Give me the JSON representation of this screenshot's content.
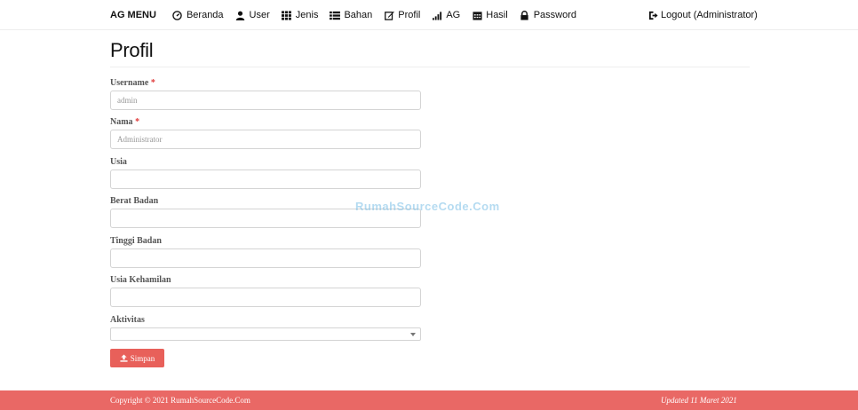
{
  "nav": {
    "brand": "AG MENU",
    "items": [
      {
        "label": "Beranda",
        "icon": "dashboard-icon"
      },
      {
        "label": "User",
        "icon": "user-icon"
      },
      {
        "label": "Jenis",
        "icon": "grid-icon"
      },
      {
        "label": "Bahan",
        "icon": "list-icon"
      },
      {
        "label": "Profil",
        "icon": "edit-icon"
      },
      {
        "label": "AG",
        "icon": "signal-icon"
      },
      {
        "label": "Hasil",
        "icon": "calendar-icon"
      },
      {
        "label": "Password",
        "icon": "lock-icon"
      }
    ],
    "logout": "Logout (Administrator)"
  },
  "page": {
    "title": "Profil"
  },
  "form": {
    "username": {
      "label": "Username",
      "required_mark": "*",
      "value": "admin"
    },
    "nama": {
      "label": "Nama",
      "required_mark": "*",
      "value": "Administrator"
    },
    "usia": {
      "label": "Usia",
      "value": ""
    },
    "berat_badan": {
      "label": "Berat Badan",
      "value": ""
    },
    "tinggi_badan": {
      "label": "Tinggi Badan",
      "value": ""
    },
    "usia_kehamilan": {
      "label": "Usia Kehamilan",
      "value": ""
    },
    "aktivitas": {
      "label": "Aktivitas",
      "value": ""
    },
    "submit_label": "Simpan"
  },
  "watermark": "RumahSourceCode.Com",
  "footer": {
    "copyright": "Copyright © 2021 RumahSourceCode.Com",
    "updated": "Updated 11 Maret 2021"
  },
  "colors": {
    "accent": "#e8605a",
    "footer_bg": "#e96865",
    "required": "#e03b3b"
  }
}
